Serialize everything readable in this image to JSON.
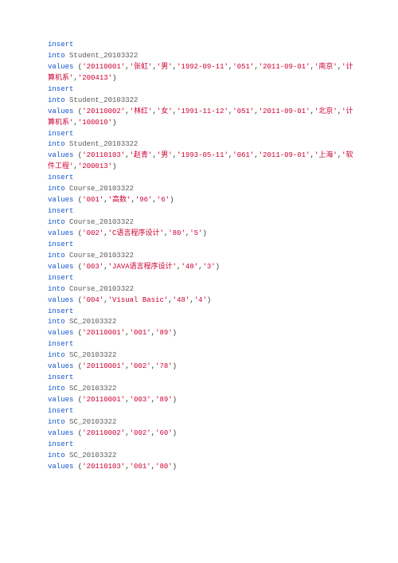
{
  "code_lines": [
    [
      {
        "c": "kw",
        "t": "insert"
      }
    ],
    [
      {
        "c": "kw",
        "t": "into"
      },
      {
        "c": "pun",
        "t": " "
      },
      {
        "c": "tbl",
        "t": "Student_20103322"
      }
    ],
    [
      {
        "c": "kw",
        "t": "values"
      },
      {
        "c": "pun",
        "t": " ("
      },
      {
        "c": "str",
        "t": "'20110001'"
      },
      {
        "c": "pun",
        "t": ","
      },
      {
        "c": "str",
        "t": "'张虹'"
      },
      {
        "c": "pun",
        "t": ","
      },
      {
        "c": "str",
        "t": "'男'"
      },
      {
        "c": "pun",
        "t": ","
      },
      {
        "c": "str",
        "t": "'1992-09-11'"
      },
      {
        "c": "pun",
        "t": ","
      },
      {
        "c": "str",
        "t": "'051'"
      },
      {
        "c": "pun",
        "t": ","
      },
      {
        "c": "str",
        "t": "'2011-09-01'"
      },
      {
        "c": "pun",
        "t": ","
      },
      {
        "c": "str",
        "t": "'南京'"
      },
      {
        "c": "pun",
        "t": ","
      },
      {
        "c": "str",
        "t": "'计算机系'"
      },
      {
        "c": "pun",
        "t": ","
      },
      {
        "c": "str",
        "t": "'200413'"
      },
      {
        "c": "pun",
        "t": ")"
      }
    ],
    [
      {
        "c": "kw",
        "t": "insert"
      }
    ],
    [
      {
        "c": "kw",
        "t": "into"
      },
      {
        "c": "pun",
        "t": " "
      },
      {
        "c": "tbl",
        "t": "Student_20103322"
      }
    ],
    [
      {
        "c": "kw",
        "t": "values"
      },
      {
        "c": "pun",
        "t": " ("
      },
      {
        "c": "str",
        "t": "'20110002'"
      },
      {
        "c": "pun",
        "t": ","
      },
      {
        "c": "str",
        "t": "'林红'"
      },
      {
        "c": "pun",
        "t": ","
      },
      {
        "c": "str",
        "t": "'女'"
      },
      {
        "c": "pun",
        "t": ","
      },
      {
        "c": "str",
        "t": "'1991-11-12'"
      },
      {
        "c": "pun",
        "t": ","
      },
      {
        "c": "str",
        "t": "'051'"
      },
      {
        "c": "pun",
        "t": ","
      },
      {
        "c": "str",
        "t": "'2011-09-01'"
      },
      {
        "c": "pun",
        "t": ","
      },
      {
        "c": "str",
        "t": "'北京'"
      },
      {
        "c": "pun",
        "t": ","
      },
      {
        "c": "str",
        "t": "'计算机系'"
      },
      {
        "c": "pun",
        "t": ","
      },
      {
        "c": "str",
        "t": "'100010'"
      },
      {
        "c": "pun",
        "t": ")"
      }
    ],
    [
      {
        "c": "kw",
        "t": "insert"
      }
    ],
    [
      {
        "c": "kw",
        "t": "into"
      },
      {
        "c": "pun",
        "t": " "
      },
      {
        "c": "tbl",
        "t": "Student_20103322"
      }
    ],
    [
      {
        "c": "kw",
        "t": "values"
      },
      {
        "c": "pun",
        "t": " ("
      },
      {
        "c": "str",
        "t": "'20110103'"
      },
      {
        "c": "pun",
        "t": ","
      },
      {
        "c": "str",
        "t": "'赵青'"
      },
      {
        "c": "pun",
        "t": ","
      },
      {
        "c": "str",
        "t": "'男'"
      },
      {
        "c": "pun",
        "t": ","
      },
      {
        "c": "str",
        "t": "'1993-05-11'"
      },
      {
        "c": "pun",
        "t": ","
      },
      {
        "c": "str",
        "t": "'061'"
      },
      {
        "c": "pun",
        "t": ","
      },
      {
        "c": "str",
        "t": "'2011-09-01'"
      },
      {
        "c": "pun",
        "t": ","
      },
      {
        "c": "str",
        "t": "'上海'"
      },
      {
        "c": "pun",
        "t": ","
      },
      {
        "c": "str",
        "t": "'软件工程'"
      },
      {
        "c": "pun",
        "t": ","
      },
      {
        "c": "str",
        "t": "'200013'"
      },
      {
        "c": "pun",
        "t": ")"
      }
    ],
    [
      {
        "c": "kw",
        "t": "insert"
      }
    ],
    [
      {
        "c": "kw",
        "t": "into"
      },
      {
        "c": "pun",
        "t": " "
      },
      {
        "c": "tbl",
        "t": "Course_20103322"
      }
    ],
    [
      {
        "c": "kw",
        "t": "values"
      },
      {
        "c": "pun",
        "t": " ("
      },
      {
        "c": "str",
        "t": "'001'"
      },
      {
        "c": "pun",
        "t": ","
      },
      {
        "c": "str",
        "t": "'高数'"
      },
      {
        "c": "pun",
        "t": ","
      },
      {
        "c": "str",
        "t": "'96'"
      },
      {
        "c": "pun",
        "t": ","
      },
      {
        "c": "str",
        "t": "'6'"
      },
      {
        "c": "pun",
        "t": ")"
      }
    ],
    [
      {
        "c": "kw",
        "t": "insert"
      }
    ],
    [
      {
        "c": "kw",
        "t": "into"
      },
      {
        "c": "pun",
        "t": " "
      },
      {
        "c": "tbl",
        "t": "Course_20103322"
      }
    ],
    [
      {
        "c": "kw",
        "t": "values"
      },
      {
        "c": "pun",
        "t": " ("
      },
      {
        "c": "str",
        "t": "'002'"
      },
      {
        "c": "pun",
        "t": ","
      },
      {
        "c": "str",
        "t": "'C语言程序设计'"
      },
      {
        "c": "pun",
        "t": ","
      },
      {
        "c": "str",
        "t": "'80'"
      },
      {
        "c": "pun",
        "t": ","
      },
      {
        "c": "str",
        "t": "'5'"
      },
      {
        "c": "pun",
        "t": ")"
      }
    ],
    [
      {
        "c": "kw",
        "t": "insert"
      }
    ],
    [
      {
        "c": "kw",
        "t": "into"
      },
      {
        "c": "pun",
        "t": " "
      },
      {
        "c": "tbl",
        "t": "Course_20103322"
      }
    ],
    [
      {
        "c": "kw",
        "t": "values"
      },
      {
        "c": "pun",
        "t": " ("
      },
      {
        "c": "str",
        "t": "'003'"
      },
      {
        "c": "pun",
        "t": ","
      },
      {
        "c": "str",
        "t": "'JAVA语言程序设计'"
      },
      {
        "c": "pun",
        "t": ","
      },
      {
        "c": "str",
        "t": "'48'"
      },
      {
        "c": "pun",
        "t": ","
      },
      {
        "c": "str",
        "t": "'3'"
      },
      {
        "c": "pun",
        "t": ")"
      }
    ],
    [
      {
        "c": "kw",
        "t": "insert"
      }
    ],
    [
      {
        "c": "kw",
        "t": "into"
      },
      {
        "c": "pun",
        "t": " "
      },
      {
        "c": "tbl",
        "t": "Course_20103322"
      }
    ],
    [
      {
        "c": "kw",
        "t": "values"
      },
      {
        "c": "pun",
        "t": " ("
      },
      {
        "c": "str",
        "t": "'004'"
      },
      {
        "c": "pun",
        "t": ","
      },
      {
        "c": "str",
        "t": "'Visual Basic'"
      },
      {
        "c": "pun",
        "t": ","
      },
      {
        "c": "str",
        "t": "'48'"
      },
      {
        "c": "pun",
        "t": ","
      },
      {
        "c": "str",
        "t": "'4'"
      },
      {
        "c": "pun",
        "t": ")"
      }
    ],
    [
      {
        "c": "kw",
        "t": "insert"
      }
    ],
    [
      {
        "c": "kw",
        "t": "into"
      },
      {
        "c": "pun",
        "t": " "
      },
      {
        "c": "tbl",
        "t": "SC_20103322"
      }
    ],
    [
      {
        "c": "kw",
        "t": "values"
      },
      {
        "c": "pun",
        "t": " ("
      },
      {
        "c": "str",
        "t": "'20110001'"
      },
      {
        "c": "pun",
        "t": ","
      },
      {
        "c": "str",
        "t": "'001'"
      },
      {
        "c": "pun",
        "t": ","
      },
      {
        "c": "str",
        "t": "'89'"
      },
      {
        "c": "pun",
        "t": ")"
      }
    ],
    [
      {
        "c": "kw",
        "t": "insert"
      }
    ],
    [
      {
        "c": "kw",
        "t": "into"
      },
      {
        "c": "pun",
        "t": " "
      },
      {
        "c": "tbl",
        "t": "SC_20103322"
      }
    ],
    [
      {
        "c": "kw",
        "t": "values"
      },
      {
        "c": "pun",
        "t": " ("
      },
      {
        "c": "str",
        "t": "'20110001'"
      },
      {
        "c": "pun",
        "t": ","
      },
      {
        "c": "str",
        "t": "'002'"
      },
      {
        "c": "pun",
        "t": ","
      },
      {
        "c": "str",
        "t": "'78'"
      },
      {
        "c": "pun",
        "t": ")"
      }
    ],
    [
      {
        "c": "kw",
        "t": "insert"
      }
    ],
    [
      {
        "c": "kw",
        "t": "into"
      },
      {
        "c": "pun",
        "t": " "
      },
      {
        "c": "tbl",
        "t": "SC_20103322"
      }
    ],
    [
      {
        "c": "kw",
        "t": "values"
      },
      {
        "c": "pun",
        "t": " ("
      },
      {
        "c": "str",
        "t": "'20110001'"
      },
      {
        "c": "pun",
        "t": ","
      },
      {
        "c": "str",
        "t": "'003'"
      },
      {
        "c": "pun",
        "t": ","
      },
      {
        "c": "str",
        "t": "'89'"
      },
      {
        "c": "pun",
        "t": ")"
      }
    ],
    [
      {
        "c": "kw",
        "t": "insert"
      }
    ],
    [
      {
        "c": "kw",
        "t": "into"
      },
      {
        "c": "pun",
        "t": " "
      },
      {
        "c": "tbl",
        "t": "SC_20103322"
      }
    ],
    [
      {
        "c": "kw",
        "t": "values"
      },
      {
        "c": "pun",
        "t": " ("
      },
      {
        "c": "str",
        "t": "'20110002'"
      },
      {
        "c": "pun",
        "t": ","
      },
      {
        "c": "str",
        "t": "'002'"
      },
      {
        "c": "pun",
        "t": ","
      },
      {
        "c": "str",
        "t": "'60'"
      },
      {
        "c": "pun",
        "t": ")"
      }
    ],
    [
      {
        "c": "kw",
        "t": "insert"
      }
    ],
    [
      {
        "c": "kw",
        "t": "into"
      },
      {
        "c": "pun",
        "t": " "
      },
      {
        "c": "tbl",
        "t": "SC_20103322"
      }
    ],
    [
      {
        "c": "kw",
        "t": "values"
      },
      {
        "c": "pun",
        "t": " ("
      },
      {
        "c": "str",
        "t": "'20110103'"
      },
      {
        "c": "pun",
        "t": ","
      },
      {
        "c": "str",
        "t": "'001'"
      },
      {
        "c": "pun",
        "t": ","
      },
      {
        "c": "str",
        "t": "'80'"
      },
      {
        "c": "pun",
        "t": ")"
      }
    ]
  ]
}
